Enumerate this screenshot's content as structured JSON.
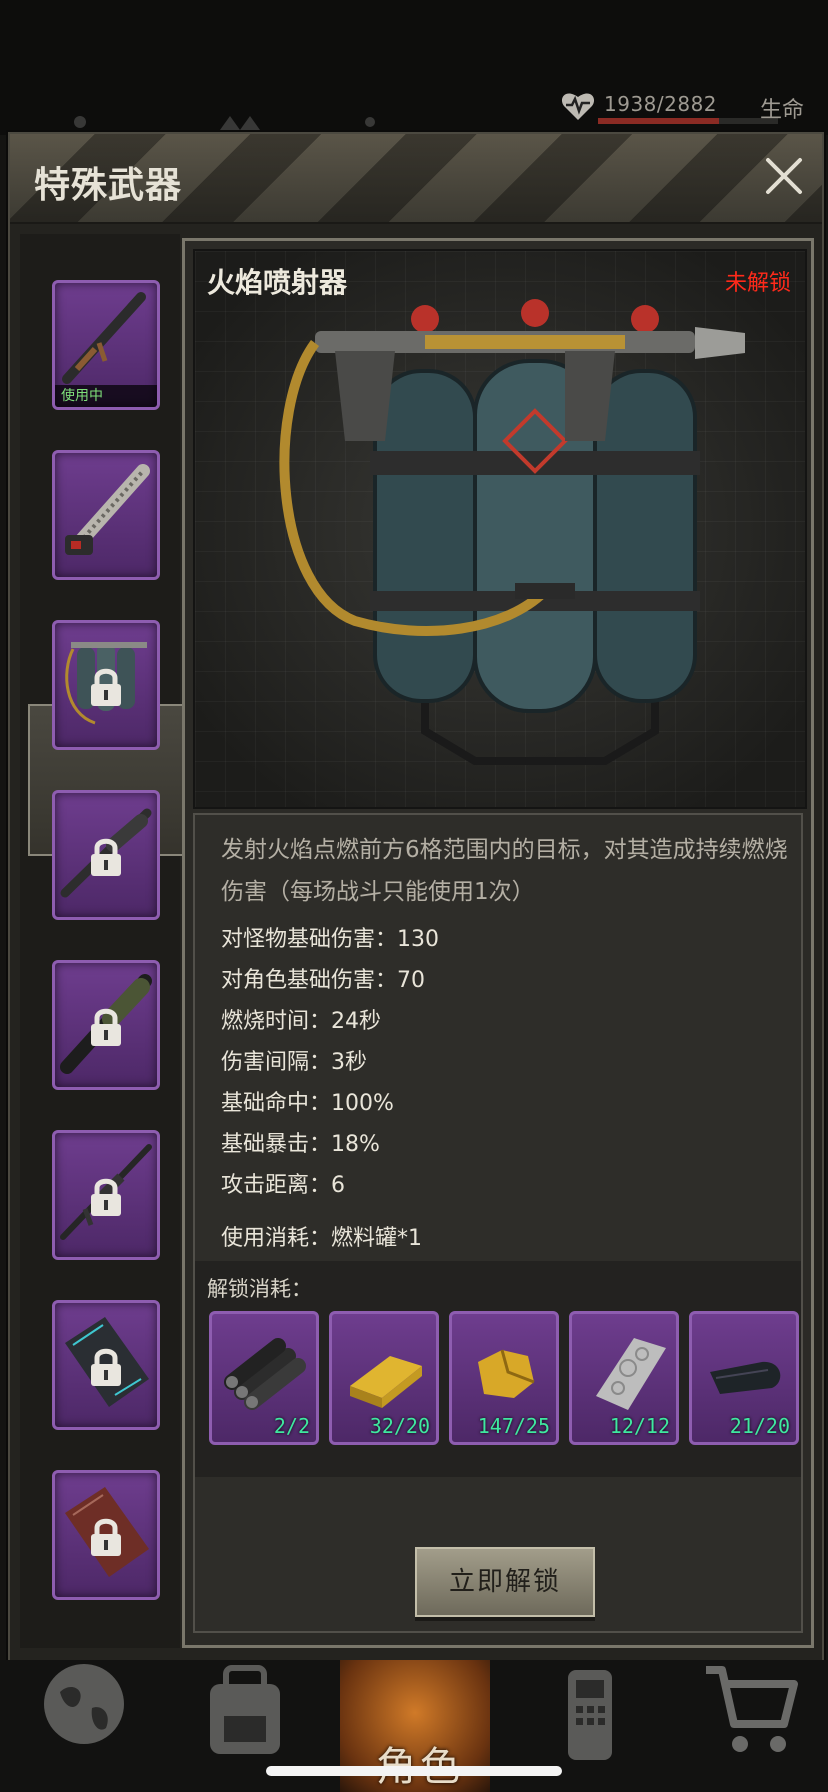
{
  "status": {
    "hp_text": "1938/2882",
    "hp_fraction": 0.67,
    "hp_label": "生命"
  },
  "dialog": {
    "title": "特殊武器",
    "close_icon": "close-icon"
  },
  "weapon_list": {
    "items": [
      {
        "name": "rocket-launcher",
        "locked": false,
        "in_use": true,
        "badge": "使用中"
      },
      {
        "name": "chainsaw",
        "locked": false,
        "in_use": false
      },
      {
        "name": "flamethrower",
        "locked": true,
        "selected": true
      },
      {
        "name": "rpg",
        "locked": true
      },
      {
        "name": "bazooka",
        "locked": true
      },
      {
        "name": "sniper-rifle",
        "locked": true
      },
      {
        "name": "tech-case",
        "locked": true
      },
      {
        "name": "red-case",
        "locked": true
      }
    ]
  },
  "detail": {
    "name": "火焰喷射器",
    "lock_status": "未解锁",
    "description": "发射火焰点燃前方6格范围内的目标，对其造成持续燃烧伤害（每场战斗只能使用1次）",
    "stats": [
      "对怪物基础伤害：130",
      "对角色基础伤害：70",
      "燃烧时间：24秒",
      "伤害间隔：3秒",
      "基础命中：100%",
      "基础暴击：18%",
      "攻击距离：6"
    ],
    "consumption": "使用消耗：燃料罐*1",
    "unlock_label": "解锁消耗：",
    "unlock_resources": [
      {
        "icon": "pipes-icon",
        "count": "2/2"
      },
      {
        "icon": "gold-bar-icon",
        "count": "32/20"
      },
      {
        "icon": "gold-nugget-icon",
        "count": "147/25"
      },
      {
        "icon": "metal-plate-icon",
        "count": "12/12"
      },
      {
        "icon": "rubber-strip-icon",
        "count": "21/20"
      }
    ],
    "unlock_button": "立即解锁"
  },
  "bottom_nav": {
    "items": [
      "globe-icon",
      "backpack-icon",
      "character-icon",
      "phone-icon",
      "cart-icon"
    ],
    "active_label": "角色"
  },
  "colors": {
    "locked_red": "#ff2a1a",
    "slot_purple": "#6e3d8e",
    "count_green": "#3fe8a0",
    "inuse_green": "#7fe07a"
  }
}
